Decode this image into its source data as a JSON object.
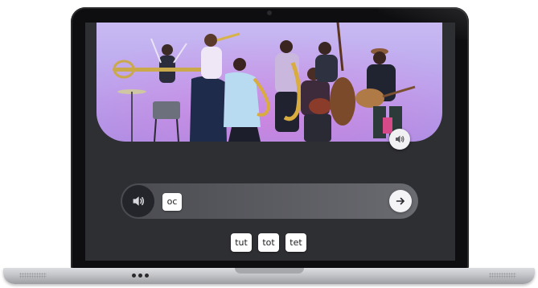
{
  "hero": {
    "image": "band-of-musicians-photo",
    "audio_icon": "speaker-icon"
  },
  "answer_bar": {
    "audio_icon": "speaker-icon",
    "answer_chip": "oc",
    "submit_icon": "arrow-right-icon"
  },
  "choices": [
    {
      "label": "tut"
    },
    {
      "label": "tot"
    },
    {
      "label": "tet"
    }
  ],
  "colors": {
    "screen_bg": "#2e2f33",
    "hero_bg": "#b8a6ee",
    "chip_bg": "#ffffff",
    "bezel": "#0e0e10"
  }
}
